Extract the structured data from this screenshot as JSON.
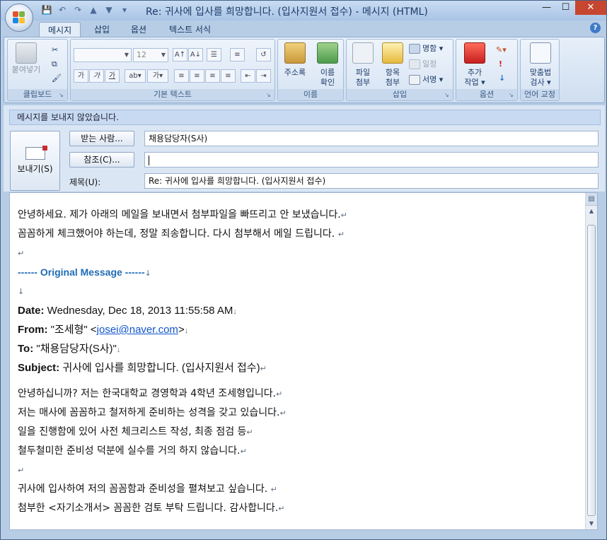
{
  "window": {
    "title": "Re: 귀사에 입사를 희망합니다. (입사지원서 접수) - 메시지 (HTML)",
    "controls": {
      "minimize": "—",
      "maximize": "☐",
      "close": "✕"
    }
  },
  "quick_access": {
    "save": "💾",
    "undo": "↶",
    "redo": "↷",
    "up": "▲",
    "down": "▼",
    "customize": "▾"
  },
  "ribbon": {
    "tabs": [
      "메시지",
      "삽입",
      "옵션",
      "텍스트 서식"
    ],
    "active_tab": "메시지",
    "groups": {
      "clipboard": {
        "label": "클립보드",
        "paste": "붙여넣기"
      },
      "basic_text": {
        "label": "기본 텍스트",
        "font_size": "12"
      },
      "names": {
        "label": "이름",
        "address_book": "주소록",
        "check_names_1": "이름",
        "check_names_2": "확인"
      },
      "insert": {
        "label": "삽입",
        "attach_1": "파일",
        "attach_2": "첨부",
        "item_1": "항목",
        "item_2": "첨부",
        "business_card": "명함",
        "calendar": "일정",
        "signature": "서명"
      },
      "options": {
        "label": "옵션",
        "follow_up_1": "추가",
        "follow_up_2": "작업"
      },
      "proofing": {
        "label": "언어 교정",
        "spelling_1": "맞춤법",
        "spelling_2": "검사"
      }
    }
  },
  "header": {
    "info_bar": "메시지를 보내지 않았습니다.",
    "send_button": "보내기(S)",
    "to_button": "받는 사람...",
    "cc_button": "참조(C)...",
    "subject_label": "제목(U):",
    "to_value": "채용담당자(S사)",
    "cc_value": "",
    "subject_value": "Re: 귀사에 입사를 희망합니다. (입사지원서 접수)"
  },
  "body": {
    "reply_lines": [
      "안녕하세요. 제가 아래의 메일을 보내면서 첨부파일을 빠뜨리고 안 보냈습니다.",
      "꼼꼼하게 체크했어야 하는데, 정말 죄송합니다. 다시 첨부해서 메일 드립니다. "
    ],
    "original_marker": "------ Original Message ------",
    "date_label": "Date:",
    "date_value": " Wednesday, Dec 18, 2013 11:55:58 AM",
    "from_label": "From:",
    "from_name": " \"조세형\" <",
    "from_email": "josei@naver.com",
    "from_close": ">",
    "to_label": "To:",
    "to_value": " \"채용담당자(S사)\"",
    "subject_label": "Subject:",
    "subject_value": " 귀사에 입사를 희망합니다. (입사지원서 접수)",
    "original_lines": [
      "안녕하십니까? 저는 한국대학교 경영학과 4학년 조세형입니다.",
      "저는 매사에 꼼꼼하고 철저하게 준비하는 성격을 갖고 있습니다.",
      "일을 진행함에 있어 사전 체크리스트 작성, 최종 점검 등",
      "철두철미한 준비성 덕분에 실수를 거의 하지 않습니다."
    ],
    "closing_lines": [
      "귀사에 입사하여 저의 꼼꼼함과 준비성을 펼쳐보고 싶습니다.    ",
      "첨부한 <자기소개서> 꼼꼼한 검토 부탁 드립니다. 감사합니다."
    ],
    "paragraph_mark": "↵",
    "line_mark": "↓"
  }
}
